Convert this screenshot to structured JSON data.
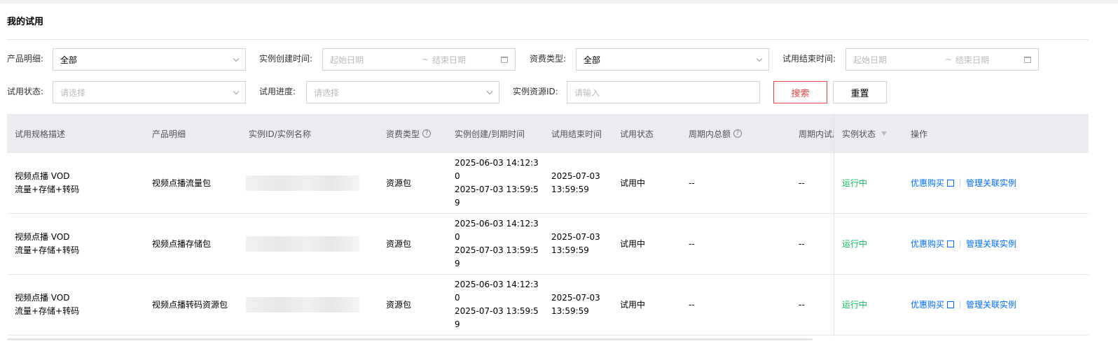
{
  "page": {
    "title": "我的试用"
  },
  "filters": {
    "product": {
      "label": "产品明细:",
      "value": "全部"
    },
    "create_time": {
      "label": "实例创建时间:",
      "start_placeholder": "起始日期",
      "end_placeholder": "结束日期",
      "sep": "~"
    },
    "billing_type": {
      "label": "资费类型:",
      "value": "全部"
    },
    "trial_end_time": {
      "label": "试用结束时间:",
      "start_placeholder": "起始日期",
      "end_placeholder": "结束日期",
      "sep": "~"
    },
    "trial_status": {
      "label": "试用状态:",
      "placeholder": "请选择"
    },
    "trial_progress": {
      "label": "试用进度:",
      "placeholder": "请选择"
    },
    "instance_id": {
      "label": "实例资源ID:",
      "placeholder": "请输入"
    },
    "search_label": "搜索",
    "reset_label": "重置"
  },
  "table": {
    "headers": {
      "spec": "试用规格描述",
      "product": "产品明细",
      "instance": "实例ID/实例名称",
      "billing": "资费类型",
      "create_expire": "实例创建/到期时间",
      "trial_end": "试用结束时间",
      "trial_status": "试用状态",
      "period_total": "周期内总额",
      "period_used": "周期内试用",
      "instance_status": "实例状态",
      "actions": "操作"
    },
    "rows": [
      {
        "spec_line1": "视频点播 VOD",
        "spec_line2": "流量+存储+转码",
        "product": "视频点播流量包",
        "billing": "资源包",
        "create_l1": "2025-06-03 14:12:3",
        "create_l2": "0",
        "expire_l1": "2025-07-03 13:59:5",
        "expire_l2": "9",
        "trial_end_l1": "2025-07-03",
        "trial_end_l2": "13:59:59",
        "trial_status": "试用中",
        "period_total": "--",
        "period_used": "--",
        "instance_status": "运行中",
        "action_buy": "优惠购买",
        "action_manage": "管理关联实例"
      },
      {
        "spec_line1": "视频点播 VOD",
        "spec_line2": "流量+存储+转码",
        "product": "视频点播存储包",
        "billing": "资源包",
        "create_l1": "2025-06-03 14:12:3",
        "create_l2": "0",
        "expire_l1": "2025-07-03 13:59:5",
        "expire_l2": "9",
        "trial_end_l1": "2025-07-03",
        "trial_end_l2": "13:59:59",
        "trial_status": "试用中",
        "period_total": "--",
        "period_used": "--",
        "instance_status": "运行中",
        "action_buy": "优惠购买",
        "action_manage": "管理关联实例"
      },
      {
        "spec_line1": "视频点播 VOD",
        "spec_line2": "流量+存储+转码",
        "product": "视频点播转码资源包",
        "billing": "资源包",
        "create_l1": "2025-06-03 14:12:3",
        "create_l2": "0",
        "expire_l1": "2025-07-03 13:59:5",
        "expire_l2": "9",
        "trial_end_l1": "2025-07-03",
        "trial_end_l2": "13:59:59",
        "trial_status": "试用中",
        "period_total": "--",
        "period_used": "--",
        "instance_status": "运行中",
        "action_buy": "优惠购买",
        "action_manage": "管理关联实例"
      }
    ]
  },
  "colors": {
    "accent": "#006eff",
    "search": "#e54545",
    "running": "#0abf5b"
  }
}
